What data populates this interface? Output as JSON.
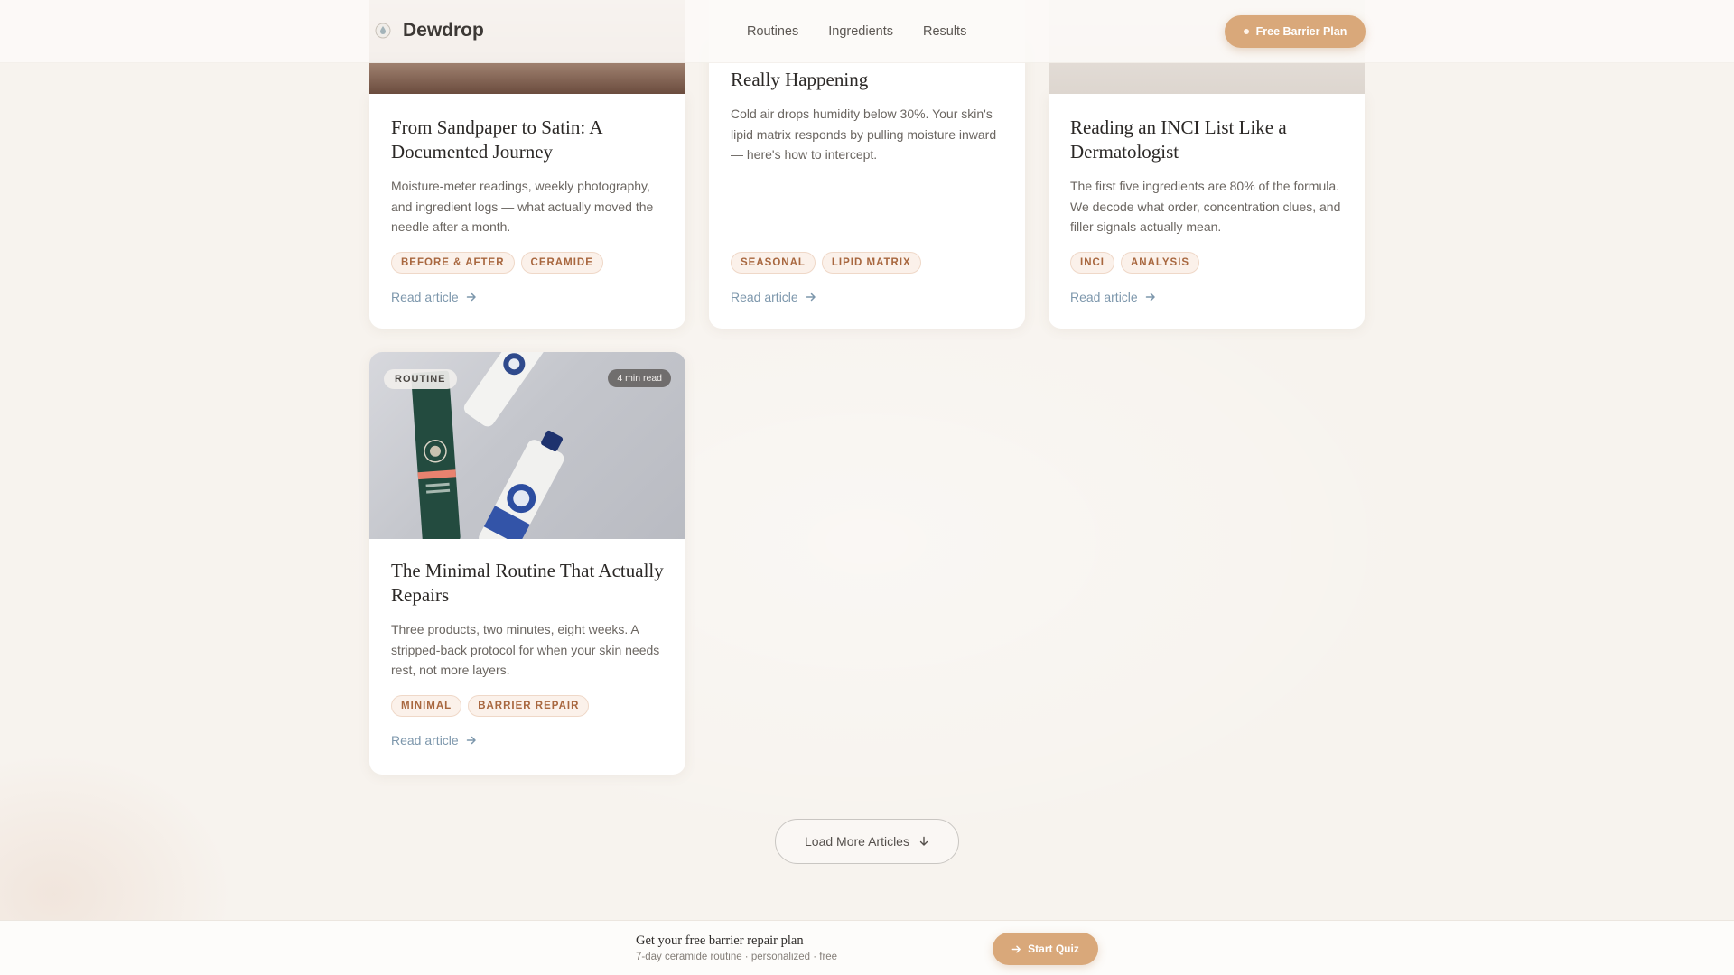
{
  "brand": {
    "name": "Dewdrop",
    "logo_icon": "droplet-icon"
  },
  "nav": {
    "items": [
      "Routines",
      "Ingredients",
      "Results"
    ]
  },
  "header_cta": {
    "label": "Free Barrier Plan"
  },
  "articles": [
    {
      "title": "From Sandpaper to Satin: A Documented Journey",
      "description": "Moisture-meter readings, weekly photography, and ingredient logs — what actually moved the needle after a month.",
      "tags": [
        "BEFORE & AFTER",
        "CERAMIDE"
      ],
      "link_label": "Read article"
    },
    {
      "title": "Really Happening",
      "description": "Cold air drops humidity below 30%. Your skin's lipid matrix responds by pulling moisture inward — here's how to intercept.",
      "tags": [
        "SEASONAL",
        "LIPID MATRIX"
      ],
      "link_label": "Read article"
    },
    {
      "title": "Reading an INCI List Like a Dermatologist",
      "description": "The first five ingredients are 80% of the formula. We decode what order, concentration clues, and filler signals actually mean.",
      "tags": [
        "INCI",
        "ANALYSIS"
      ],
      "link_label": "Read article"
    },
    {
      "category": "ROUTINE",
      "read_time": "4 min read",
      "title": "The Minimal Routine That Actually Repairs",
      "description": "Three products, two minutes, eight weeks. A stripped-back protocol for when your skin needs rest, not more layers.",
      "tags": [
        "MINIMAL",
        "BARRIER REPAIR"
      ],
      "link_label": "Read article"
    }
  ],
  "load_more": {
    "label": "Load More Articles"
  },
  "bottom_bar": {
    "title": "Get your free barrier repair plan",
    "subtitle": "7-day ceramide routine · personalized · free",
    "cta_label": "Start Quiz"
  },
  "colors": {
    "accent": "#d9a87a",
    "tag_text": "#a8673f",
    "link": "#7d97ac",
    "page_bg": "#f7f3ee"
  }
}
